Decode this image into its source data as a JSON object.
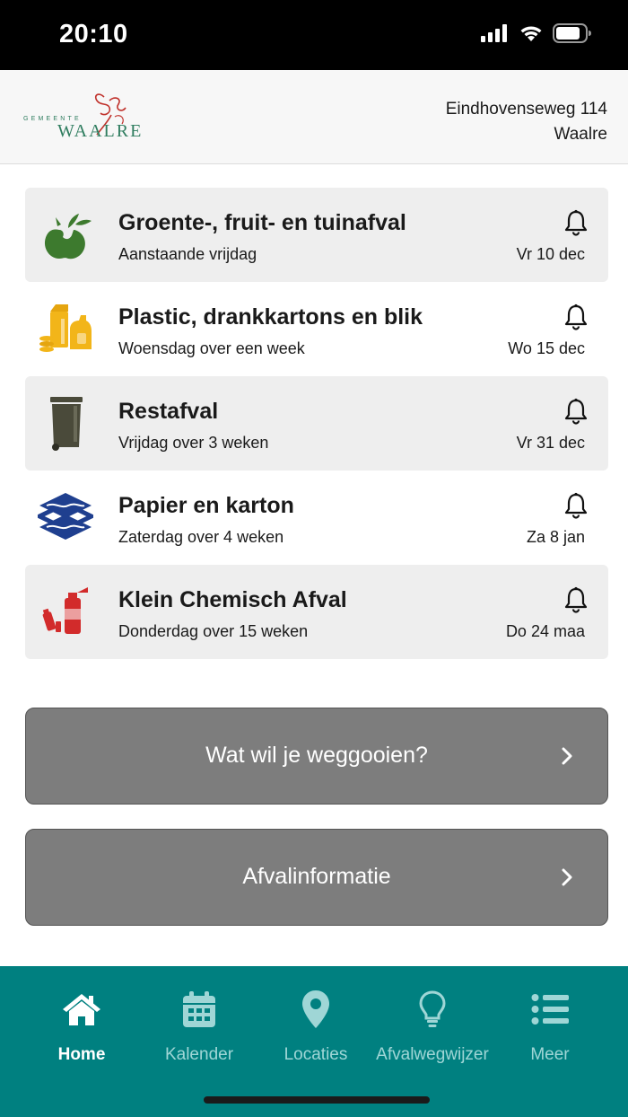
{
  "status_bar": {
    "time": "20:10"
  },
  "header": {
    "logo_small": "GEMEENTE",
    "logo_name": "WAALRE",
    "address_line1": "Eindhovenseweg 114",
    "address_line2": "Waalre"
  },
  "waste_items": [
    {
      "icon": "gft-apple-icon",
      "title": "Groente-, fruit- en tuinafval",
      "subtitle": "Aanstaande vrijdag",
      "date": "Vr 10 dec",
      "color": "#3d7a2e"
    },
    {
      "icon": "plastic-bottles-icon",
      "title": "Plastic, drankkartons en blik",
      "subtitle": "Woensdag over een week",
      "date": "Wo 15 dec",
      "color": "#f2b519"
    },
    {
      "icon": "container-bin-icon",
      "title": "Restafval",
      "subtitle": "Vrijdag over 3 weken",
      "date": "Vr 31 dec",
      "color": "#4a4a3a"
    },
    {
      "icon": "paper-stack-icon",
      "title": "Papier en karton",
      "subtitle": "Zaterdag over 4 weken",
      "date": "Za 8 jan",
      "color": "#1f3f8f"
    },
    {
      "icon": "chemical-canisters-icon",
      "title": "Klein Chemisch Afval",
      "subtitle": "Donderdag over 15 weken",
      "date": "Do 24 maa",
      "color": "#d22b2b"
    }
  ],
  "buttons": {
    "what_to_throw": "Wat wil je weggooien?",
    "waste_info": "Afvalinformatie"
  },
  "tabs": [
    {
      "label": "Home",
      "icon": "home-icon",
      "active": true
    },
    {
      "label": "Kalender",
      "icon": "calendar-icon",
      "active": false
    },
    {
      "label": "Locaties",
      "icon": "location-pin-icon",
      "active": false
    },
    {
      "label": "Afvalwegwijzer",
      "icon": "lightbulb-icon",
      "active": false
    },
    {
      "label": "Meer",
      "icon": "list-icon",
      "active": false
    }
  ],
  "colors": {
    "tabbar": "#008080",
    "button": "#7d7d7d",
    "card_shade": "#eeeeee"
  }
}
